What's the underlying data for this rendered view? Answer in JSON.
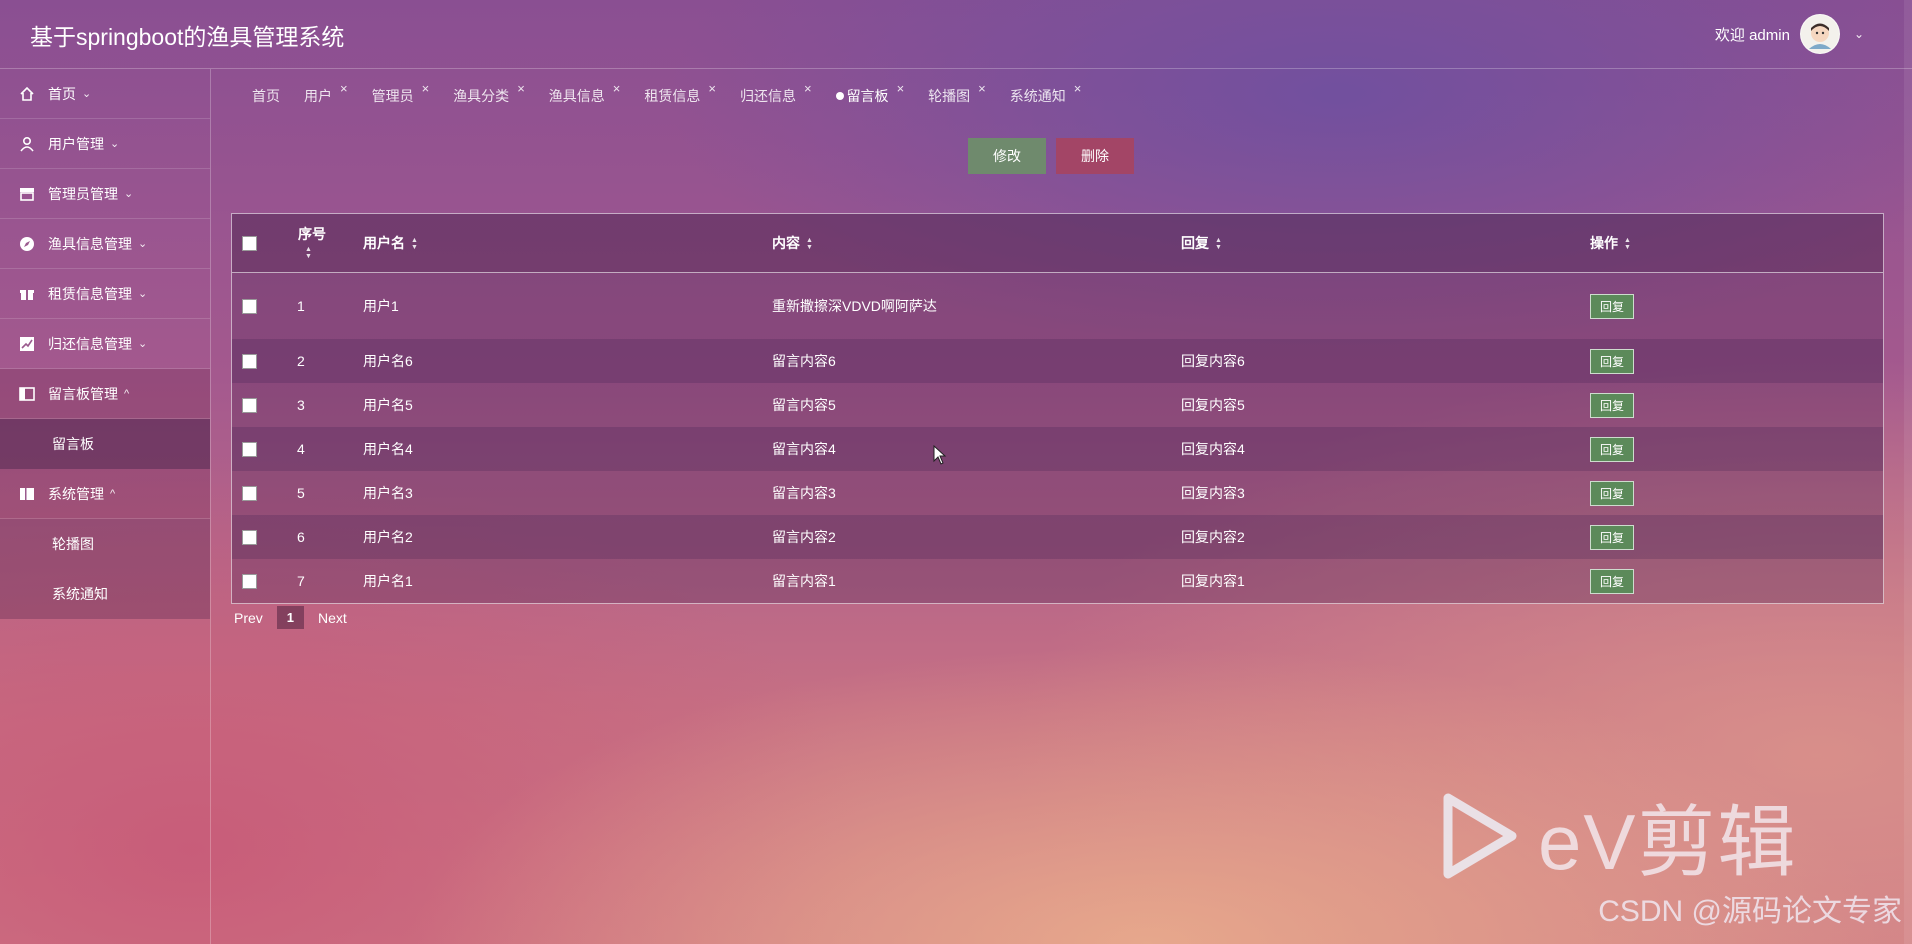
{
  "app": {
    "title": "基于springboot的渔具管理系统",
    "welcome": "欢迎 admin"
  },
  "sidebar": {
    "items": [
      {
        "label": "首页",
        "icon": "home-icon",
        "arrow": "v"
      },
      {
        "label": "用户管理",
        "icon": "user-icon",
        "arrow": "v"
      },
      {
        "label": "管理员管理",
        "icon": "store-icon",
        "arrow": "v"
      },
      {
        "label": "渔具信息管理",
        "icon": "compass-icon",
        "arrow": "v"
      },
      {
        "label": "租赁信息管理",
        "icon": "gift-icon",
        "arrow": "v"
      },
      {
        "label": "归还信息管理",
        "icon": "chart-icon",
        "arrow": "v"
      },
      {
        "label": "留言板管理",
        "icon": "board-icon",
        "arrow": "^",
        "sub": [
          "留言板"
        ]
      },
      {
        "label": "系统管理",
        "icon": "columns-icon",
        "arrow": "^",
        "sub": [
          "轮播图",
          "系统通知"
        ]
      }
    ]
  },
  "tabs": [
    "首页",
    "用户",
    "管理员",
    "渔具分类",
    "渔具信息",
    "租赁信息",
    "归还信息",
    "留言板",
    "轮播图",
    "系统通知"
  ],
  "toolbar": {
    "edit_label": "修改",
    "delete_label": "删除"
  },
  "table": {
    "headers": [
      "序号",
      "用户名",
      "内容",
      "回复",
      "操作"
    ],
    "rows": [
      {
        "no": "1",
        "user": "用户1",
        "content": "重新撒擦深VDVD啊阿萨达",
        "reply": "",
        "action": "回复"
      },
      {
        "no": "2",
        "user": "用户名6",
        "content": "留言内容6",
        "reply": "回复内容6",
        "action": "回复"
      },
      {
        "no": "3",
        "user": "用户名5",
        "content": "留言内容5",
        "reply": "回复内容5",
        "action": "回复"
      },
      {
        "no": "4",
        "user": "用户名4",
        "content": "留言内容4",
        "reply": "回复内容4",
        "action": "回复"
      },
      {
        "no": "5",
        "user": "用户名3",
        "content": "留言内容3",
        "reply": "回复内容3",
        "action": "回复"
      },
      {
        "no": "6",
        "user": "用户名2",
        "content": "留言内容2",
        "reply": "回复内容2",
        "action": "回复"
      },
      {
        "no": "7",
        "user": "用户名1",
        "content": "留言内容1",
        "reply": "回复内容1",
        "action": "回复"
      }
    ]
  },
  "pager": {
    "prev": "Prev",
    "page": "1",
    "next": "Next"
  },
  "watermark": {
    "brand": "eV剪辑",
    "credit": "CSDN @源码论文专家"
  }
}
